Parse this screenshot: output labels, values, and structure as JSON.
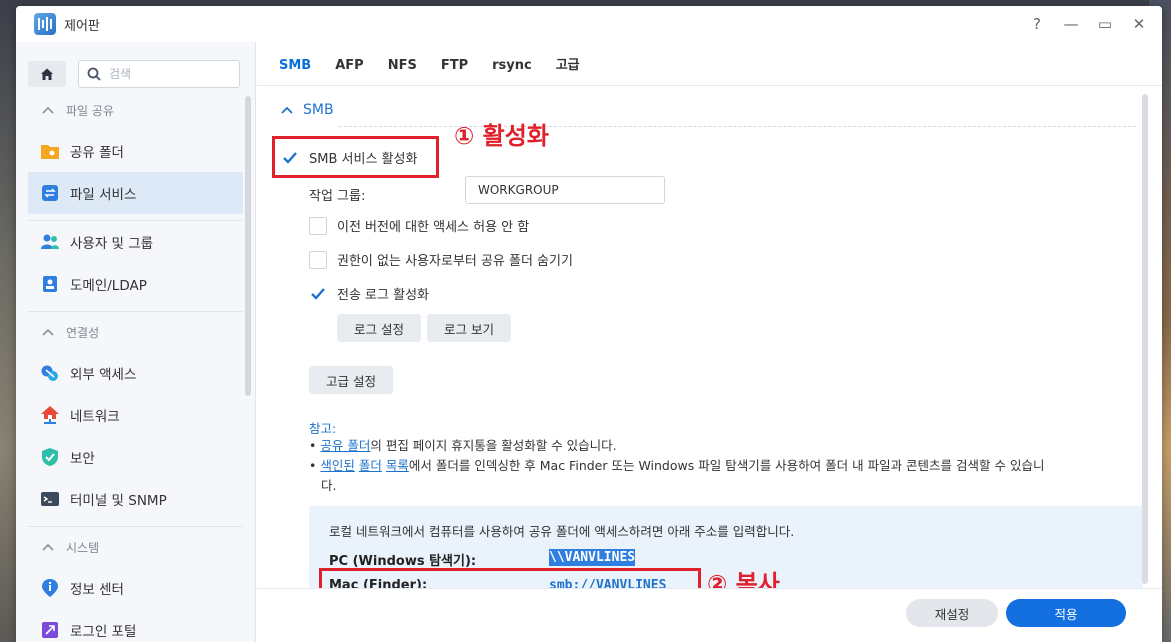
{
  "window": {
    "title": "제어판",
    "controls": [
      "?",
      "—",
      "▭",
      "✕"
    ]
  },
  "sidebar": {
    "search_placeholder": "검색",
    "sections": [
      {
        "label": "파일 공유",
        "items": [
          {
            "label": "공유 폴더",
            "icon": "shared-folder-icon"
          },
          {
            "label": "파일 서비스",
            "icon": "file-services-icon",
            "active": true
          }
        ]
      },
      {
        "label": "",
        "items": [
          {
            "label": "사용자 및 그룹",
            "icon": "users-icon"
          },
          {
            "label": "도메인/LDAP",
            "icon": "domain-icon"
          }
        ]
      },
      {
        "label": "연결성",
        "items": [
          {
            "label": "외부 액세스",
            "icon": "external-access-icon"
          },
          {
            "label": "네트워크",
            "icon": "network-icon"
          },
          {
            "label": "보안",
            "icon": "security-icon"
          },
          {
            "label": "터미널 및 SNMP",
            "icon": "terminal-icon"
          }
        ]
      },
      {
        "label": "시스템",
        "items": [
          {
            "label": "정보 센터",
            "icon": "info-center-icon"
          },
          {
            "label": "로그인 포털",
            "icon": "login-portal-icon"
          }
        ]
      }
    ]
  },
  "tabs": [
    {
      "label": "SMB",
      "active": true
    },
    {
      "label": "AFP"
    },
    {
      "label": "NFS"
    },
    {
      "label": "FTP"
    },
    {
      "label": "rsync"
    },
    {
      "label": "고급"
    }
  ],
  "smb": {
    "section_title": "SMB",
    "enable_label": "SMB 서비스 활성화",
    "enable_checked": true,
    "workgroup_label": "작업 그룹:",
    "workgroup_value": "WORKGROUP",
    "prev_version_label": "이전 버전에 대한 액세스 허용 안 함",
    "prev_version_checked": false,
    "hide_folders_label": "권한이 없는 사용자로부터 공유 폴더 숨기기",
    "hide_folders_checked": false,
    "transfer_log_label": "전송 로그 활성화",
    "transfer_log_checked": true,
    "log_settings_btn": "로그 설정",
    "log_view_btn": "로그 보기",
    "advanced_btn": "고급 설정"
  },
  "notes": {
    "title": "참고:",
    "line1_link": "공유 폴더",
    "line1_text": "의 편집 페이지 휴지통을 활성화할 수 있습니다.",
    "line2_link1": "색인된",
    "line2_link2": "폴더",
    "line2_link3": "목록",
    "line2_text": "에서 폴더를 인덱싱한 후 Mac Finder 또는 Windows 파일 탐색기를 사용하여 폴더 내 파일과 콘텐츠를 검색할 수 있습니",
    "line2_cont": "다."
  },
  "info": {
    "text": "로컬 네트워크에서 컴퓨터를 사용하여 공유 폴더에 액세스하려면 아래 주소를 입력합니다.",
    "pc_label": "PC (Windows 탐색기):",
    "pc_value": "\\\\VANVLINES",
    "mac_label": "Mac (Finder):",
    "mac_value": "smb://VANVLINES"
  },
  "annotations": {
    "step1": "① 활성화",
    "step2": "② 복사"
  },
  "footer": {
    "reset": "재설정",
    "apply": "적용"
  },
  "colors": {
    "accent": "#1470e0",
    "annotation_red": "#e0202a"
  }
}
